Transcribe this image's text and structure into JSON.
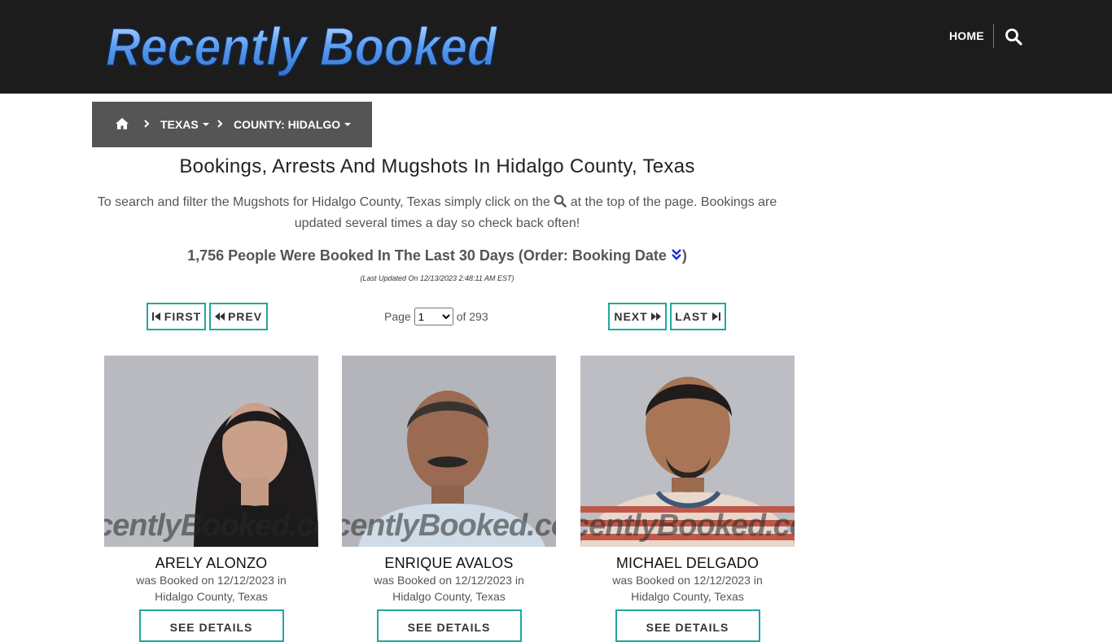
{
  "header": {
    "logo_text": "Recently Booked",
    "nav_home": "HOME",
    "search_icon": "search-icon"
  },
  "breadcrumb": {
    "home_icon": "home-icon",
    "items": [
      {
        "label": "TEXAS"
      },
      {
        "label": "COUNTY: HIDALGO"
      }
    ]
  },
  "main": {
    "title": "Bookings, Arrests And Mugshots In Hidalgo County, Texas",
    "intro_before": "To search and filter the Mugshots for Hidalgo County, Texas simply click on the",
    "intro_after": "at the top of the page. Bookings are updated several times a day so check back often!",
    "count_text": "1,756 People Were Booked In The Last 30 Days (Order: Booking Date",
    "count_close": ")",
    "last_updated": "(Last Updated On 12/13/2023 2:48:11 AM EST)"
  },
  "pagination": {
    "first": "FIRST",
    "prev": "PREV",
    "next": "NEXT",
    "last": "LAST",
    "page_label": "Page",
    "page_value": "1",
    "of_label": "of 293"
  },
  "watermark": "centlyBooked.co",
  "cards": [
    {
      "name": "ARELY ALONZO",
      "booked": "was Booked on 12/12/2023 in",
      "location": "Hidalgo County, Texas",
      "button": "SEE DETAILS"
    },
    {
      "name": "ENRIQUE AVALOS",
      "booked": "was Booked on 12/12/2023 in",
      "location": "Hidalgo County, Texas",
      "button": "SEE DETAILS"
    },
    {
      "name": "MICHAEL DELGADO",
      "booked": "was Booked on 12/12/2023 in",
      "location": "Hidalgo County, Texas",
      "button": "SEE DETAILS"
    }
  ],
  "colors": {
    "header_bg": "#1c1c1c",
    "breadcrumb_bg": "#555555",
    "button_border": "#1fa8a0",
    "logo_blue": "#4a8fe6"
  }
}
